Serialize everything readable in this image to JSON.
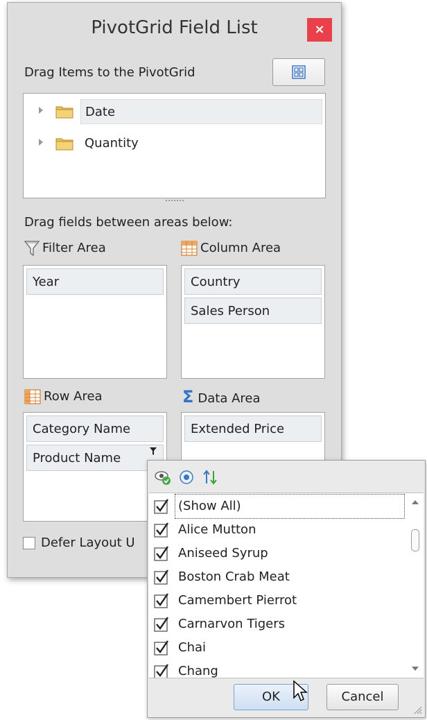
{
  "window": {
    "title": "PivotGrid Field List",
    "close_glyph": "×"
  },
  "top": {
    "drag_items_label": "Drag Items to the PivotGrid",
    "layout_button_icon": "layout-grid-icon"
  },
  "tree": {
    "items": [
      {
        "label": "Date",
        "icon": "folder-icon"
      },
      {
        "label": "Quantity",
        "icon": "folder-icon"
      }
    ]
  },
  "areas": {
    "drag_fields_label": "Drag fields between areas below:",
    "filter": {
      "title": "Filter Area",
      "icon": "filter-icon",
      "fields": [
        "Year"
      ]
    },
    "column": {
      "title": "Column Area",
      "icon": "column-grid-icon",
      "fields": [
        "Country",
        "Sales Person"
      ]
    },
    "row": {
      "title": "Row Area",
      "icon": "row-grid-icon",
      "fields": [
        "Category Name",
        "Product Name"
      ]
    },
    "data": {
      "title": "Data Area",
      "icon": "sigma-icon",
      "fields": [
        "Extended Price"
      ]
    }
  },
  "defer": {
    "label": "Defer Layout U",
    "checked": false
  },
  "filter_popup": {
    "toolbar_icons": [
      "show-only-visible-icon",
      "radio-mode-icon",
      "sort-icon"
    ],
    "items": [
      {
        "label": "(Show All)",
        "checked": true
      },
      {
        "label": "Alice Mutton",
        "checked": true
      },
      {
        "label": "Aniseed Syrup",
        "checked": true
      },
      {
        "label": "Boston Crab Meat",
        "checked": true
      },
      {
        "label": "Camembert Pierrot",
        "checked": true
      },
      {
        "label": "Carnarvon Tigers",
        "checked": true
      },
      {
        "label": "Chai",
        "checked": true
      },
      {
        "label": "Chang",
        "checked": true
      }
    ],
    "ok_label": "OK",
    "cancel_label": "Cancel"
  },
  "colors": {
    "close_button": "#e8414b",
    "field_background": "#eceff2",
    "window_background": "#dedede",
    "folder": "#e8c25a"
  }
}
